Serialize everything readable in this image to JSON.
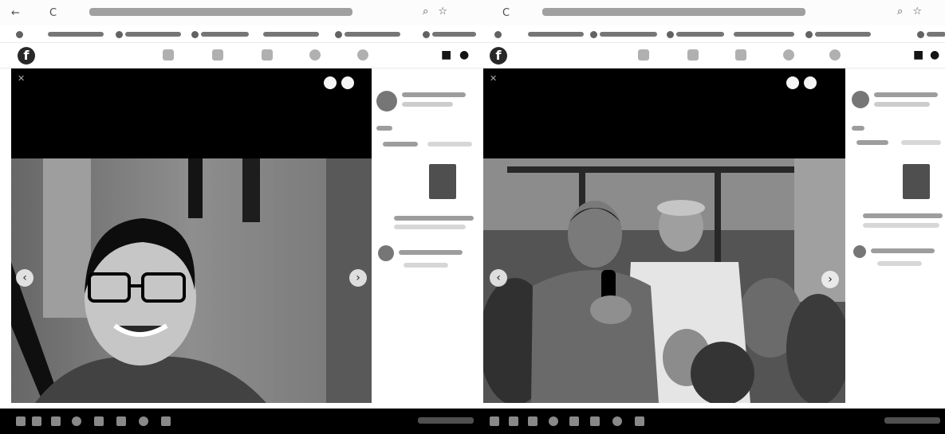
{
  "browser": {
    "nav_back": "←",
    "nav_forward": "→",
    "reload": "C",
    "toolbar_right": "⌕ ☆"
  },
  "facebook": {
    "logo": "f"
  },
  "viewer": {
    "close": "✕",
    "prev": "‹",
    "next": "›"
  },
  "colors": {
    "viewer_bg": "#0c0c0c",
    "taskbar_bg": "#111111",
    "page_bg": "#fafafa"
  },
  "icons": [
    "back-arrow-icon",
    "reload-icon",
    "search-icon",
    "star-icon",
    "facebook-logo-icon",
    "home-icon",
    "video-icon",
    "marketplace-icon",
    "groups-icon",
    "gaming-icon",
    "messenger-icon",
    "notifications-icon",
    "close-icon",
    "chevron-left-icon",
    "chevron-right-icon",
    "document-icon"
  ]
}
